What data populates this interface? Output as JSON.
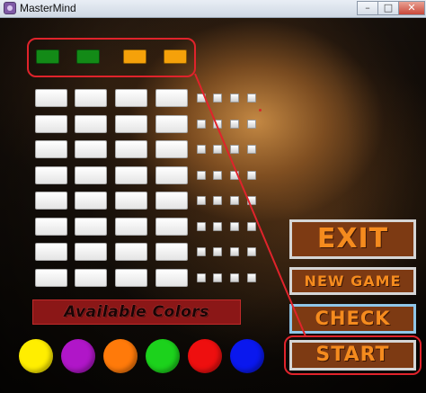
{
  "window": {
    "title": "MasterMind",
    "controls": [
      "–",
      "□",
      "✕"
    ]
  },
  "secret_code": {
    "pegs": [
      {
        "color": "#138a17"
      },
      {
        "color": "#138a17"
      },
      {
        "color": "#f5a10a"
      },
      {
        "color": "#f5a10a"
      }
    ]
  },
  "guess_board": {
    "rows": 8,
    "cells_per_row": 4,
    "hint_pegs_per_row": 4
  },
  "available_colors": {
    "label": "Available Colors",
    "colors": [
      {
        "name": "yellow",
        "hex": "#ffee00"
      },
      {
        "name": "purple",
        "hex": "#b016c8"
      },
      {
        "name": "orange",
        "hex": "#ff7a0a"
      },
      {
        "name": "green",
        "hex": "#1cd21c"
      },
      {
        "name": "red",
        "hex": "#ee0f0f"
      },
      {
        "name": "blue",
        "hex": "#0a18ee"
      }
    ]
  },
  "buttons": {
    "exit": "EXIT",
    "new_game": "NEW GAME",
    "check": "CHECK",
    "start": "START"
  },
  "theme": {
    "button_text": "#f58b1e",
    "button_bg": "#7d3a13",
    "annotation": "#e0232b"
  }
}
